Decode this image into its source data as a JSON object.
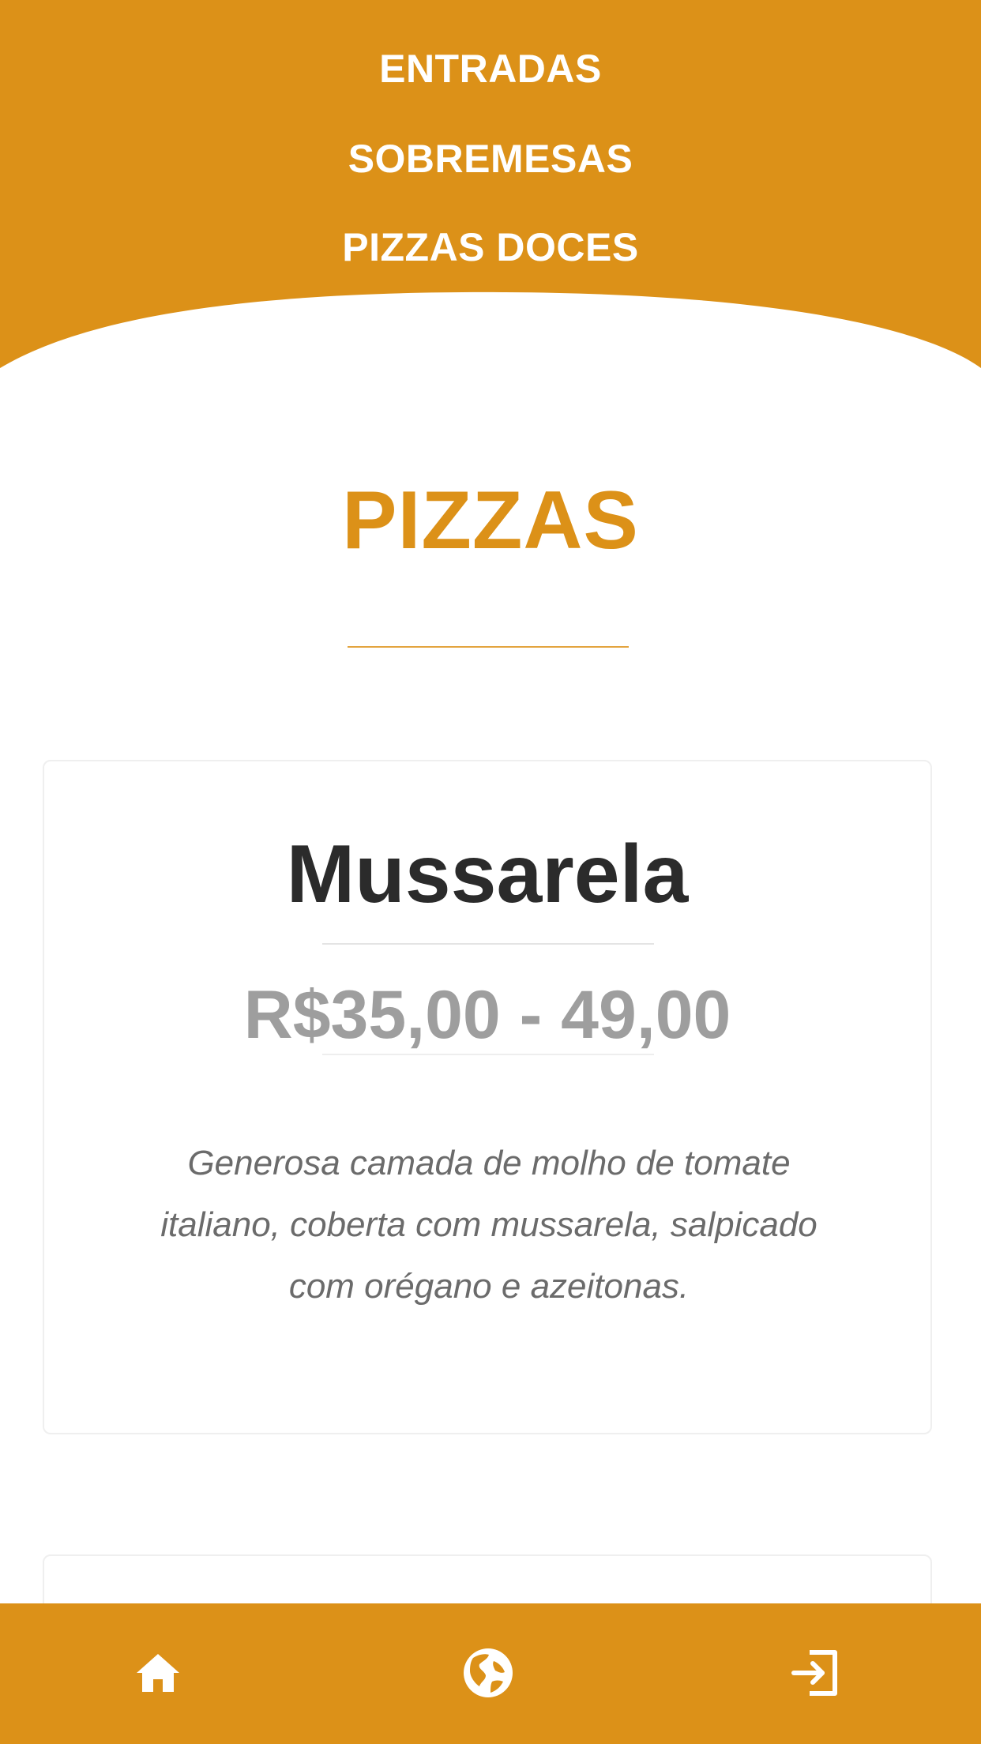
{
  "colors": {
    "accent": "#dc9118",
    "white": "#ffffff",
    "title_text": "#2b2b2b",
    "price_text": "#9e9e9e",
    "description_text": "#6b6b6b"
  },
  "nav": {
    "items": [
      {
        "label": "ENTRADAS"
      },
      {
        "label": "SOBREMESAS"
      },
      {
        "label": "PIZZAS DOCES"
      }
    ]
  },
  "section": {
    "title": "PIZZAS"
  },
  "products": [
    {
      "name": "Mussarela",
      "price": "R$35,00 - 49,00",
      "description": "Generosa camada de molho de tomate italiano, coberta com mussarela, salpicado com orégano e azeitonas."
    }
  ],
  "bottom_nav": {
    "icons": [
      "home-icon",
      "globe-icon",
      "exit-icon"
    ]
  }
}
